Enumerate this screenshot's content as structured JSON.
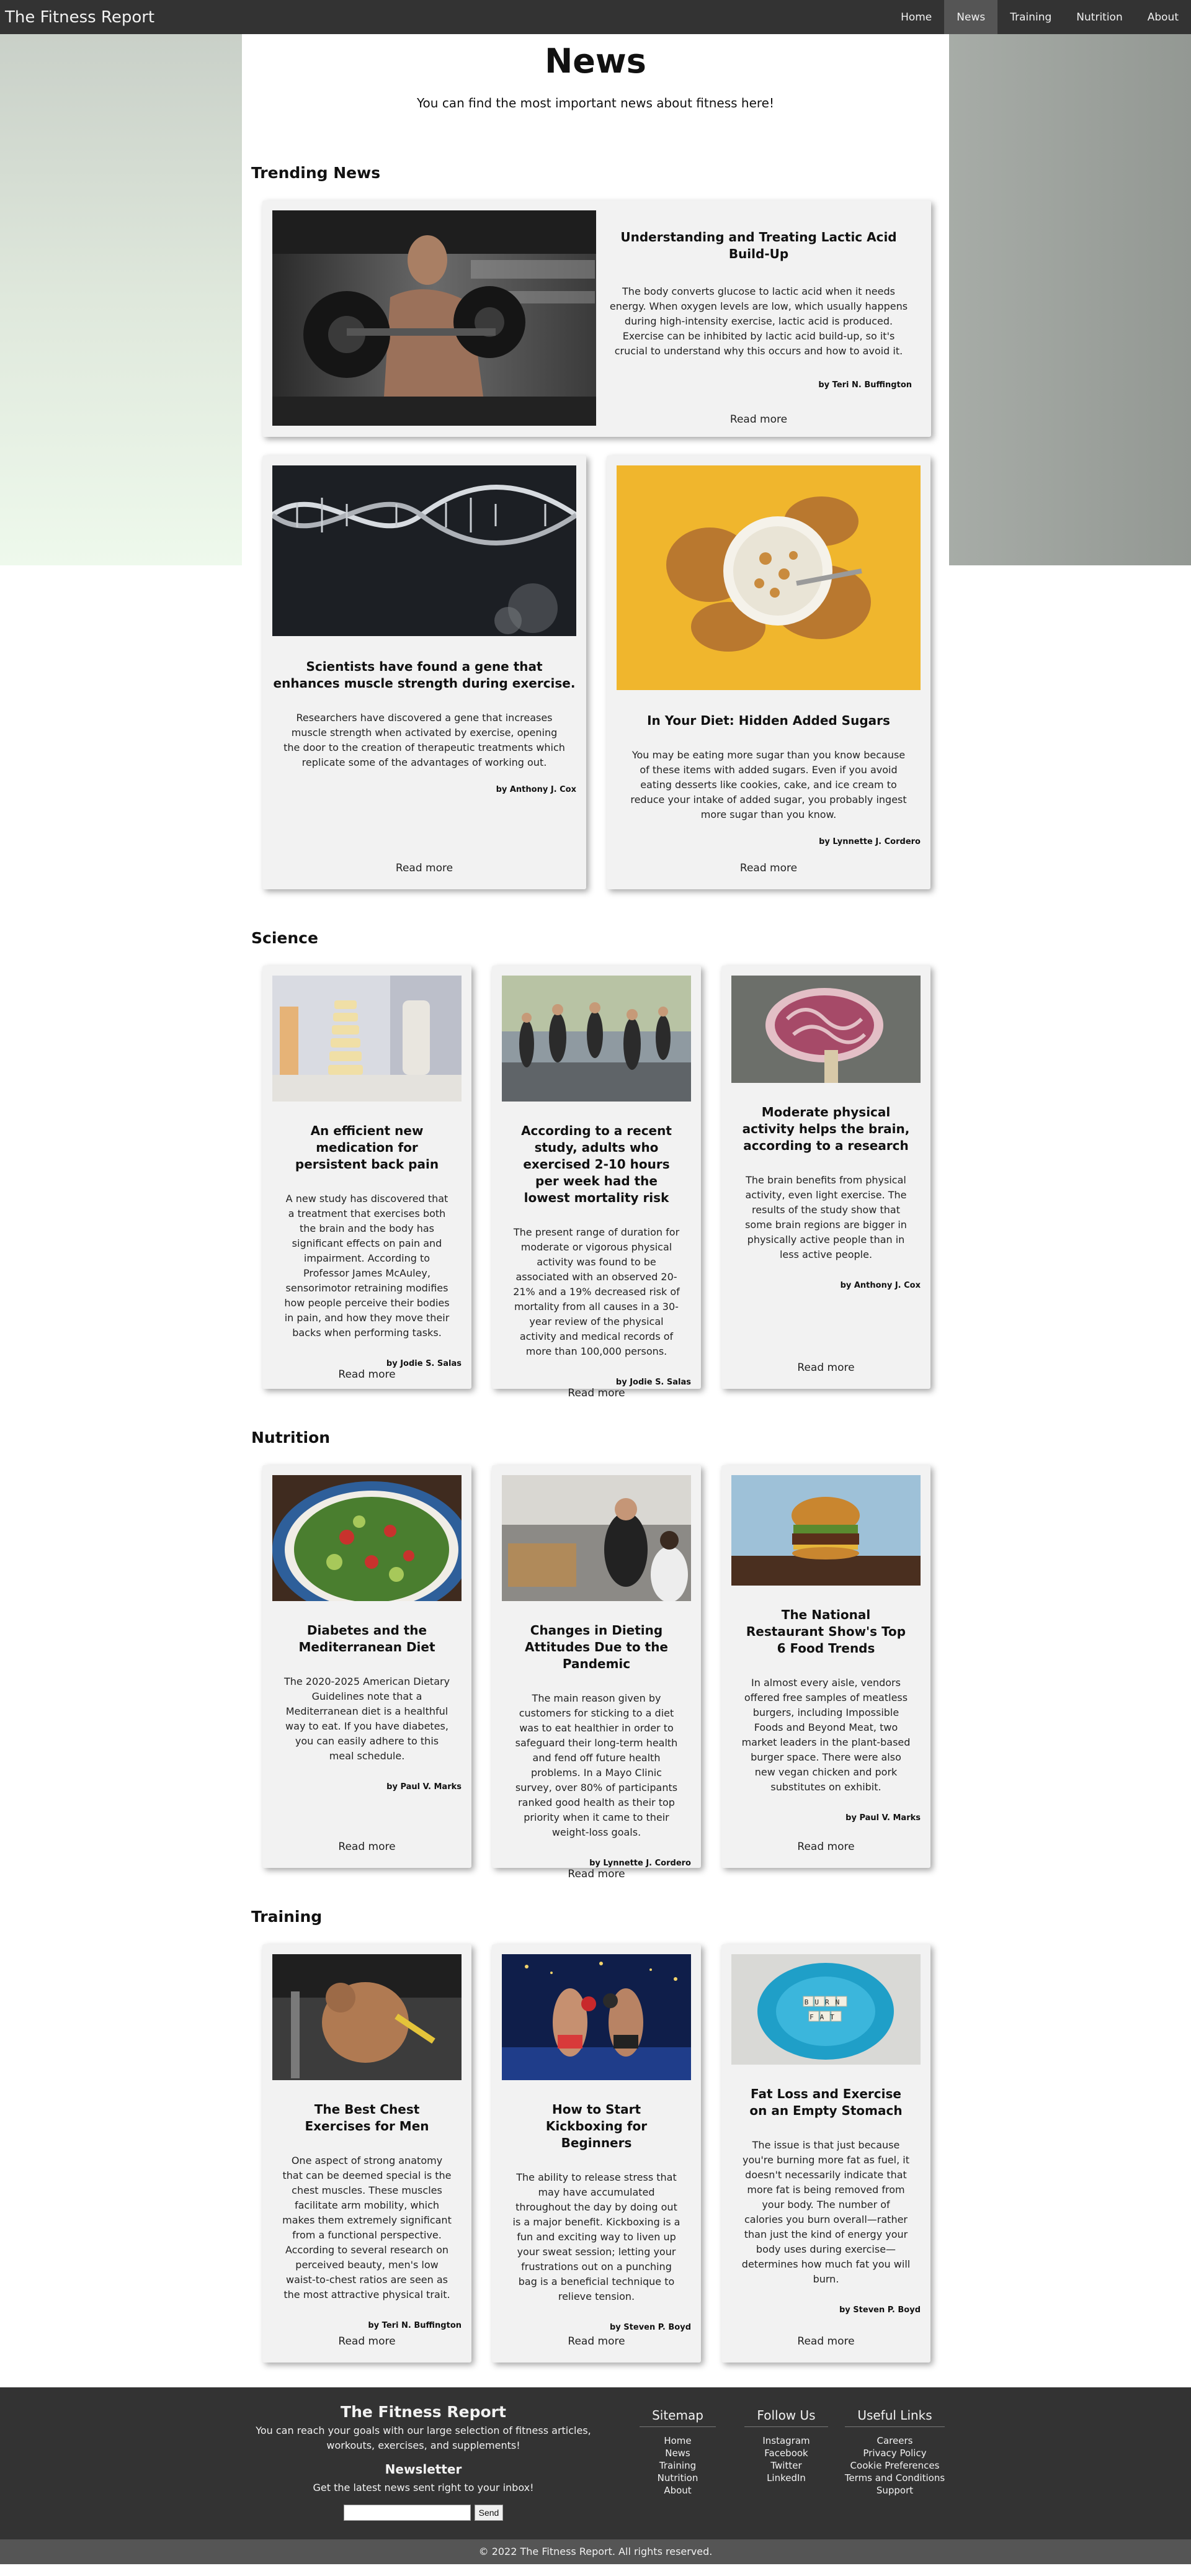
{
  "navbar": {
    "brand": "The Fitness Report",
    "links": [
      "Home",
      "News",
      "Training",
      "Nutrition",
      "About"
    ],
    "active": "News"
  },
  "page": {
    "title": "News",
    "subtitle": "You can find the most important news about fitness here!"
  },
  "sections": {
    "trending": {
      "title": "Trending News",
      "featured": {
        "title": "Understanding and Treating Lactic Acid Build-Up",
        "text": "The body converts glucose to lactic acid when it needs energy. When oxygen levels are low, which usually happens during high-intensity exercise, lactic acid is produced. Exercise can be inhibited by lactic acid build-up, so it's crucial to understand why this occurs and how to avoid it.",
        "author": "by Teri N. Buffington",
        "read_more": "Read more"
      },
      "cards": [
        {
          "title": "Scientists have found a gene that enhances muscle strength during exercise.",
          "text": "Researchers have discovered a gene that increases muscle strength when activated by exercise, opening the door to the creation of therapeutic treatments which replicate some of the advantages of working out.",
          "author": "by Anthony J. Cox",
          "read_more": "Read more"
        },
        {
          "title": "In Your Diet: Hidden Added Sugars",
          "text": "You may be eating more sugar than you know because of these items with added sugars. Even if you avoid eating desserts like cookies, cake, and ice cream to reduce your intake of added sugar, you probably ingest more sugar than you know.",
          "author": "by Lynnette J. Cordero",
          "read_more": "Read more"
        }
      ]
    },
    "science": {
      "title": "Science",
      "cards": [
        {
          "title": "An efficient new medication for persistent back pain",
          "text": "A new study has discovered that a treatment that exercises both the brain and the body has significant effects on pain and impairment. According to Professor James McAuley, sensorimotor retraining modifies how people perceive their bodies in pain, and how they move their backs when performing tasks.",
          "author": "by Jodie S. Salas",
          "read_more": "Read more"
        },
        {
          "title": "According to a recent study, adults who exercised 2-10 hours per week had the lowest mortality risk",
          "text": "The present range of duration for moderate or vigorous physical activity was found to be associated with an observed 20-21% and a 19% decreased risk of mortality from all causes in a 30-year review of the physical activity and medical records of more than 100,000 persons.",
          "author": "by Jodie S. Salas",
          "read_more": "Read more"
        },
        {
          "title": "Moderate physical activity helps the brain, according to a research",
          "text": "The brain benefits from physical activity, even light exercise. The results of the study show that some brain regions are bigger in physically active people than in less active people.",
          "author": "by Anthony J. Cox",
          "read_more": "Read more"
        }
      ]
    },
    "nutrition": {
      "title": "Nutrition",
      "cards": [
        {
          "title": "Diabetes and the Mediterranean Diet",
          "text": "The 2020-2025 American Dietary Guidelines note that a Mediterranean diet is a healthful way to eat. If you have diabetes, you can easily adhere to this meal schedule.",
          "author": "by Paul V. Marks",
          "read_more": "Read more"
        },
        {
          "title": "Changes in Dieting Attitudes Due to the Pandemic",
          "text": "The main reason given by customers for sticking to a diet was to eat healthier in order to safeguard their long-term health and fend off future health problems. In a Mayo Clinic survey, over 80% of participants ranked good health as their top priority when it came to their weight-loss goals.",
          "author": "by Lynnette J. Cordero",
          "read_more": "Read more"
        },
        {
          "title": "The National Restaurant Show's Top 6 Food Trends",
          "text": "In almost every aisle, vendors offered free samples of meatless burgers, including Impossible Foods and Beyond Meat, two market leaders in the plant-based burger space. There were also new vegan chicken and pork substitutes on exhibit.",
          "author": "by Paul V. Marks",
          "read_more": "Read more"
        }
      ]
    },
    "training": {
      "title": "Training",
      "cards": [
        {
          "title": "The Best Chest Exercises for Men",
          "text": "One aspect of strong anatomy that can be deemed special is the chest muscles. These muscles facilitate arm mobility, which makes them extremely significant from a functional perspective. According to several research on perceived beauty, men's low waist-to-chest ratios are seen as the most attractive physical trait.",
          "author": "by Teri N. Buffington",
          "read_more": "Read more"
        },
        {
          "title": "How to Start Kickboxing for Beginners",
          "text": "The ability to release stress that may have accumulated throughout the day by doing out is a major benefit. Kickboxing is a fun and exciting way to liven up your sweat session; letting your frustrations out on a punching bag is a beneficial technique to relieve tension.",
          "author": "by Steven P. Boyd",
          "read_more": "Read more"
        },
        {
          "title": "Fat Loss and Exercise on an Empty Stomach",
          "text": "The issue is that just because you're burning more fat as fuel, it doesn't necessarily indicate that more fat is being removed from your body. The number of calories you burn overall—rather than just the kind of energy your body uses during exercise—determines how much fat you will burn.",
          "author": "by Steven P. Boyd",
          "read_more": "Read more"
        }
      ]
    }
  },
  "images": {
    "burn_fat_tiles_top": "BURN",
    "burn_fat_tiles_bottom": "FAT"
  },
  "footer": {
    "brand": "The Fitness Report",
    "description": "You can reach your goals with our large selection of fitness articles, workouts, exercises, and supplements!",
    "newsletter_title": "Newsletter",
    "newsletter_desc": "Get the latest news sent right to your inbox!",
    "newsletter_value": "",
    "send_label": "Send",
    "columns": [
      {
        "title": "Sitemap",
        "items": [
          "Home",
          "News",
          "Training",
          "Nutrition",
          "About"
        ]
      },
      {
        "title": "Follow Us",
        "items": [
          "Instagram",
          "Facebook",
          "Twitter",
          "LinkedIn"
        ]
      },
      {
        "title": "Useful Links",
        "items": [
          "Careers",
          "Privacy Policy",
          "Cookie Preferences",
          "Terms and Conditions",
          "Support"
        ]
      }
    ],
    "copyright": "© 2022 The Fitness Report. All rights reserved."
  }
}
